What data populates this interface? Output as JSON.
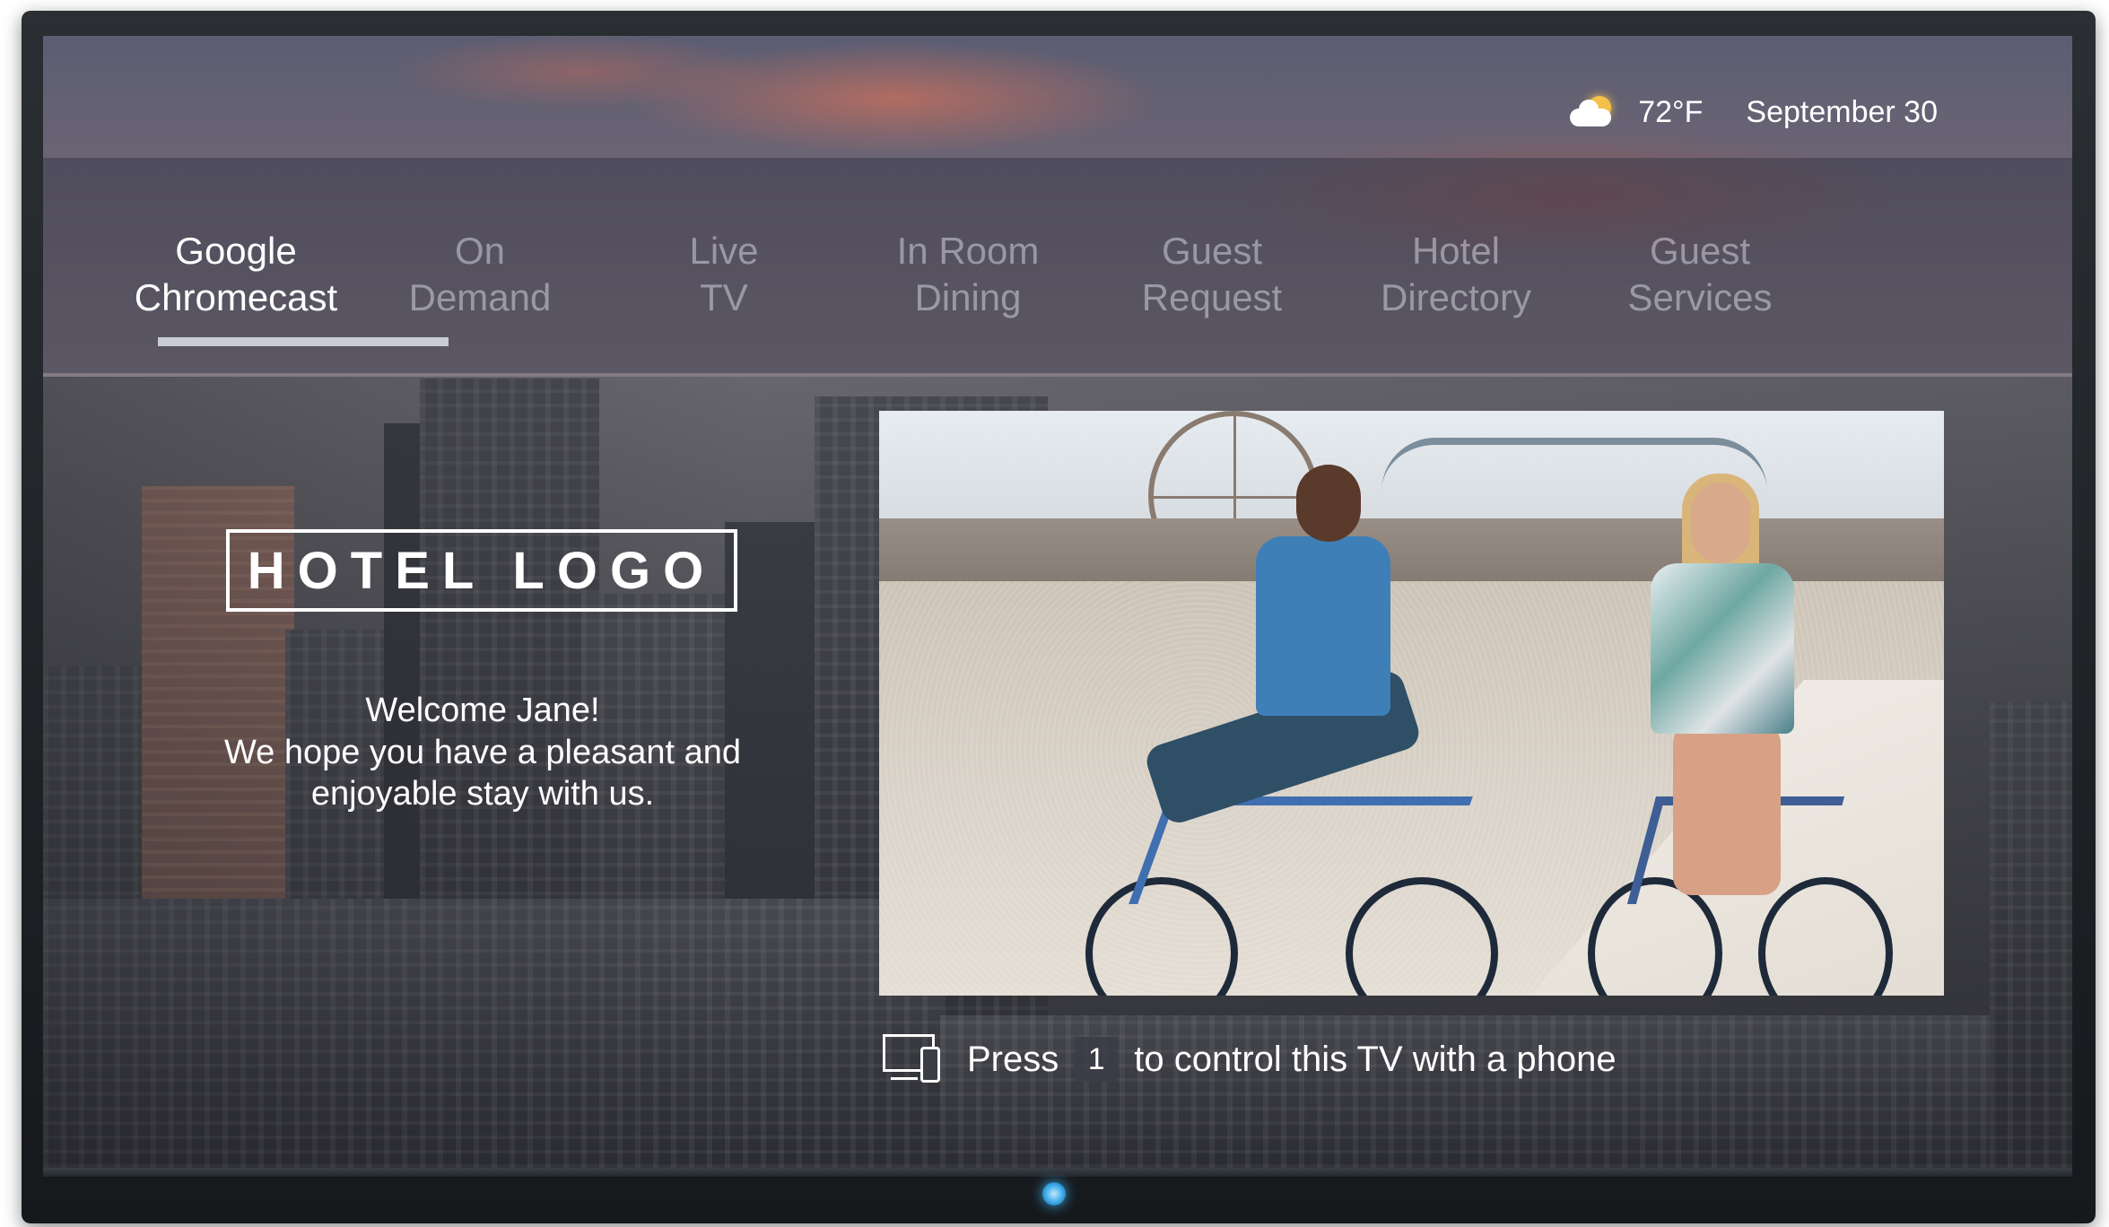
{
  "status": {
    "weather_icon": "partly-cloudy-icon",
    "temperature": "72°F",
    "date": "September 30"
  },
  "nav": {
    "tabs": [
      {
        "label": "Google\nChromecast",
        "active": true
      },
      {
        "label": "On\nDemand",
        "active": false
      },
      {
        "label": "Live\nTV",
        "active": false
      },
      {
        "label": "In Room\nDining",
        "active": false
      },
      {
        "label": "Guest\nRequest",
        "active": false
      },
      {
        "label": "Hotel\nDirectory",
        "active": false
      },
      {
        "label": "Guest\nServices",
        "active": false
      }
    ]
  },
  "branding": {
    "logo_text": "HOTEL LOGO"
  },
  "welcome": {
    "greeting": "Welcome Jane!",
    "message": "We hope you have a pleasant and enjoyable stay with us."
  },
  "hint": {
    "icon": "phone-cast-icon",
    "prefix": "Press",
    "key": "1",
    "suffix": "to control this TV with a phone"
  },
  "colors": {
    "accent": "#c9cbd6",
    "power_led": "#3aa8e6"
  }
}
